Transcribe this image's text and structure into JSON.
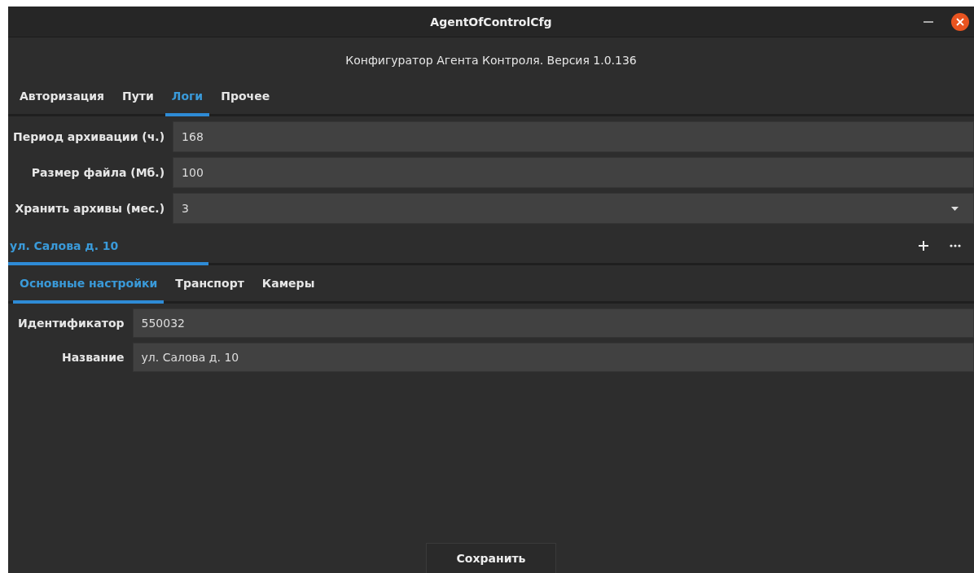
{
  "window": {
    "title": "AgentOfControlCfg"
  },
  "header": "Конфигуратор Агента Контроля. Версия 1.0.136",
  "tabs": [
    {
      "label": "Авторизация",
      "selected": false
    },
    {
      "label": "Пути",
      "selected": false
    },
    {
      "label": "Логи",
      "selected": true
    },
    {
      "label": "Прочее",
      "selected": false
    }
  ],
  "log_fields": [
    {
      "kind": "text",
      "label": "Период архивации (ч.)",
      "value": "168"
    },
    {
      "kind": "text",
      "label": "Размер файла (Мб.)",
      "value": "100"
    },
    {
      "kind": "combo",
      "label": "Хранить архивы (мес.)",
      "value": "3"
    }
  ],
  "objects": {
    "tabs": [
      {
        "label": "ул. Салова д. 10",
        "selected": true
      }
    ]
  },
  "subtabs": [
    {
      "label": "Основные настройки",
      "selected": true
    },
    {
      "label": "Транспорт",
      "selected": false
    },
    {
      "label": "Камеры",
      "selected": false
    }
  ],
  "object_fields": [
    {
      "label": "Идентификатор",
      "value": "550032"
    },
    {
      "label": "Название",
      "value": "ул. Салова д. 10"
    }
  ],
  "save_button": "Сохранить"
}
